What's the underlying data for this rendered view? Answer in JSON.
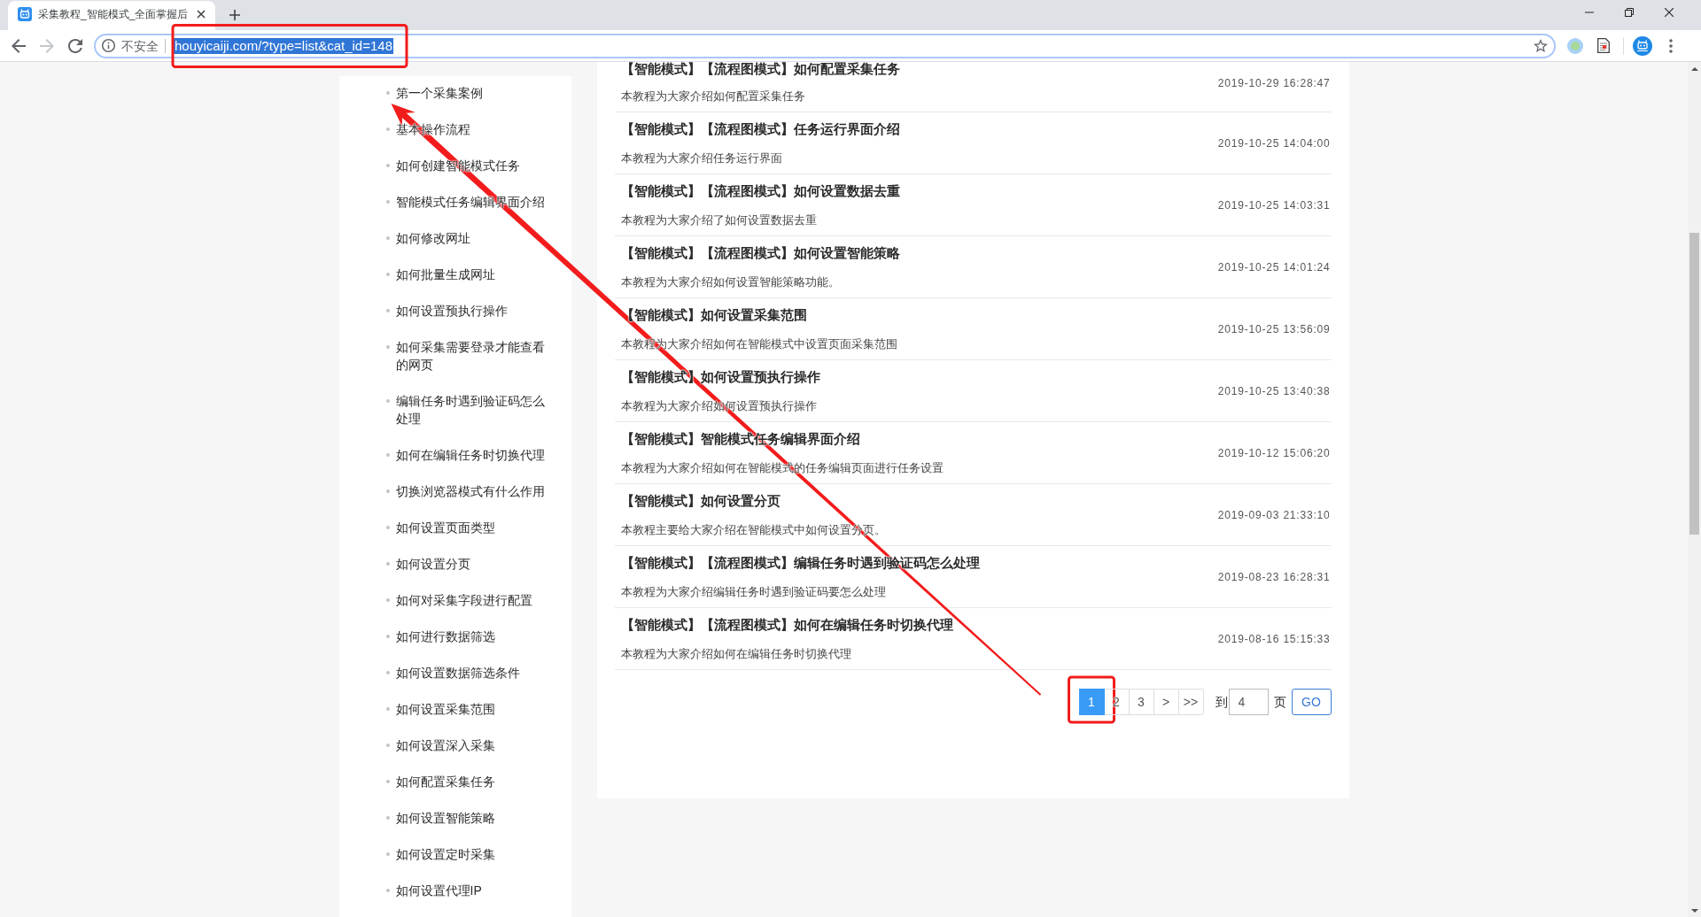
{
  "browser_tabs": [
    {
      "title": "采集教程_智能模式_全面掌握后",
      "selected": true
    }
  ],
  "toolbar": {
    "forward_disabled": true
  },
  "address_bar": {
    "security_label": "不安全",
    "url": "houyicaiji.com/?type=list&cat_id=148",
    "url_selected": true,
    "boxed": true
  },
  "sidebar": {
    "items": [
      {
        "label": "第一个采集案例"
      },
      {
        "label": "基本操作流程"
      },
      {
        "label": "如何创建智能模式任务"
      },
      {
        "label": "智能模式任务编辑界面介绍"
      },
      {
        "label": "如何修改网址"
      },
      {
        "label": "如何批量生成网址"
      },
      {
        "label": "如何设置预执行操作"
      },
      {
        "label": "如何采集需要登录才能查看的网页"
      },
      {
        "label": "编辑任务时遇到验证码怎么处理"
      },
      {
        "label": "如何在编辑任务时切换代理"
      },
      {
        "label": "切换浏览器模式有什么作用"
      },
      {
        "label": "如何设置页面类型"
      },
      {
        "label": "如何设置分页"
      },
      {
        "label": "如何对采集字段进行配置"
      },
      {
        "label": "如何进行数据筛选"
      },
      {
        "label": "如何设置数据筛选条件"
      },
      {
        "label": "如何设置采集范围"
      },
      {
        "label": "如何设置深入采集"
      },
      {
        "label": "如何配置采集任务"
      },
      {
        "label": "如何设置智能策略"
      },
      {
        "label": "如何设置定时采集"
      },
      {
        "label": "如何设置代理IP"
      }
    ]
  },
  "articles": [
    {
      "title": "【智能模式】【流程图模式】如何配置采集任务",
      "summary": "本教程为大家介绍如何配置采集任务",
      "date": "2019-10-29 16:28:47"
    },
    {
      "title": "【智能模式】【流程图模式】任务运行界面介绍",
      "summary": "本教程为大家介绍任务运行界面",
      "date": "2019-10-25 14:04:00"
    },
    {
      "title": "【智能模式】【流程图模式】如何设置数据去重",
      "summary": "本教程为大家介绍了如何设置数据去重",
      "date": "2019-10-25 14:03:31"
    },
    {
      "title": "【智能模式】【流程图模式】如何设置智能策略",
      "summary": "本教程为大家介绍如何设置智能策略功能。",
      "date": "2019-10-25 14:01:24"
    },
    {
      "title": "【智能模式】如何设置采集范围",
      "summary": "本教程为大家介绍如何在智能模式中设置页面采集范围",
      "date": "2019-10-25 13:56:09"
    },
    {
      "title": "【智能模式】如何设置预执行操作",
      "summary": "本教程为大家介绍如何设置预执行操作",
      "date": "2019-10-25 13:40:38"
    },
    {
      "title": "【智能模式】智能模式任务编辑界面介绍",
      "summary": "本教程为大家介绍如何在智能模式的任务编辑页面进行任务设置",
      "date": "2019-10-12 15:06:20"
    },
    {
      "title": "【智能模式】如何设置分页",
      "summary": "本教程主要给大家介绍在智能模式中如何设置分页。",
      "date": "2019-09-03 21:33:10"
    },
    {
      "title": "【智能模式】【流程图模式】编辑任务时遇到验证码怎么处理",
      "summary": "本教程为大家介绍编辑任务时遇到验证码要怎么处理",
      "date": "2019-08-23 16:28:31"
    },
    {
      "title": "【智能模式】【流程图模式】如何在编辑任务时切换代理",
      "summary": "本教程为大家介绍如何在编辑任务时切换代理",
      "date": "2019-08-16 15:15:33"
    }
  ],
  "pagination": {
    "pages": [
      {
        "label": "1",
        "selected": true,
        "boxed": true
      },
      {
        "label": "2",
        "selected": false,
        "boxed": false
      },
      {
        "label": "3",
        "selected": false,
        "boxed": false
      }
    ],
    "next": ">",
    "last": ">>",
    "goto_label": "到",
    "goto_value": "4",
    "goto_unit": "页",
    "go_button": "GO"
  },
  "annotation_arrow": true
}
